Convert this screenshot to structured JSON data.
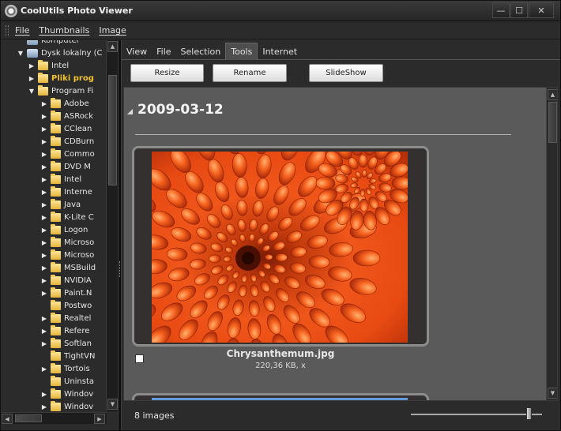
{
  "app": {
    "title": "CoolUtils Photo Viewer"
  },
  "window_controls": {
    "minimize": "—",
    "maximize": "☐",
    "close": "✕"
  },
  "menu": [
    "File",
    "Thumbnails",
    "Image"
  ],
  "tree": {
    "items": [
      {
        "label": "Komputer",
        "level": 0,
        "arrow": "",
        "icon": "computer"
      },
      {
        "label": "Dysk lokalny (C",
        "level": 0,
        "arrow": "▼",
        "icon": "drive"
      },
      {
        "label": "Intel",
        "level": 1,
        "arrow": "▶",
        "icon": "folder"
      },
      {
        "label": "Pliki prog",
        "level": 1,
        "arrow": "▶",
        "icon": "folder",
        "bold": true
      },
      {
        "label": "Program Fi",
        "level": 1,
        "arrow": "▼",
        "icon": "folder"
      },
      {
        "label": "Adobe",
        "level": 2,
        "arrow": "▶",
        "icon": "folder"
      },
      {
        "label": "ASRock",
        "level": 2,
        "arrow": "▶",
        "icon": "folder"
      },
      {
        "label": "CClean",
        "level": 2,
        "arrow": "▶",
        "icon": "folder"
      },
      {
        "label": "CDBurn",
        "level": 2,
        "arrow": "▶",
        "icon": "folder"
      },
      {
        "label": "Commo",
        "level": 2,
        "arrow": "▶",
        "icon": "folder"
      },
      {
        "label": "DVD M",
        "level": 2,
        "arrow": "▶",
        "icon": "folder"
      },
      {
        "label": "Intel",
        "level": 2,
        "arrow": "▶",
        "icon": "folder"
      },
      {
        "label": "Interne",
        "level": 2,
        "arrow": "▶",
        "icon": "folder"
      },
      {
        "label": "Java",
        "level": 2,
        "arrow": "▶",
        "icon": "folder"
      },
      {
        "label": "K-Lite C",
        "level": 2,
        "arrow": "▶",
        "icon": "folder"
      },
      {
        "label": "Logon",
        "level": 2,
        "arrow": "▶",
        "icon": "folder"
      },
      {
        "label": "Microso",
        "level": 2,
        "arrow": "▶",
        "icon": "folder"
      },
      {
        "label": "Microso",
        "level": 2,
        "arrow": "▶",
        "icon": "folder"
      },
      {
        "label": "MSBuild",
        "level": 2,
        "arrow": "▶",
        "icon": "folder"
      },
      {
        "label": "NVIDIA",
        "level": 2,
        "arrow": "▶",
        "icon": "folder"
      },
      {
        "label": "Paint.N",
        "level": 2,
        "arrow": "▶",
        "icon": "folder"
      },
      {
        "label": "Postwo",
        "level": 2,
        "arrow": "",
        "icon": "folder"
      },
      {
        "label": "Realtel",
        "level": 2,
        "arrow": "▶",
        "icon": "folder"
      },
      {
        "label": "Refere",
        "level": 2,
        "arrow": "▶",
        "icon": "folder"
      },
      {
        "label": "Softlan",
        "level": 2,
        "arrow": "▶",
        "icon": "folder"
      },
      {
        "label": "TightVN",
        "level": 2,
        "arrow": "",
        "icon": "folder"
      },
      {
        "label": "Tortois",
        "level": 2,
        "arrow": "▶",
        "icon": "folder"
      },
      {
        "label": "Uninsta",
        "level": 2,
        "arrow": "",
        "icon": "folder"
      },
      {
        "label": "Windov",
        "level": 2,
        "arrow": "▶",
        "icon": "folder"
      },
      {
        "label": "Windov",
        "level": 2,
        "arrow": "▶",
        "icon": "folder"
      }
    ]
  },
  "tabs": [
    {
      "label": "View",
      "active": false
    },
    {
      "label": "File",
      "active": false
    },
    {
      "label": "Selection",
      "active": false
    },
    {
      "label": "Tools",
      "active": true
    },
    {
      "label": "Internet",
      "active": false
    }
  ],
  "toolbar": {
    "resize": "Resize",
    "rename": "Rename",
    "slideshow": "SlideShow"
  },
  "gallery": {
    "group_date": "2009-03-12",
    "items": [
      {
        "filename": "Chrysanthemum.jpg",
        "meta": "220,36 KB, x",
        "checked": false
      }
    ]
  },
  "status": {
    "count_text": "8 images",
    "zoom_level": 0.88
  },
  "colors": {
    "accent_folder": "#f2c233",
    "gallery_bg": "#5a5a5a",
    "window_bg": "#2b2b2b"
  }
}
